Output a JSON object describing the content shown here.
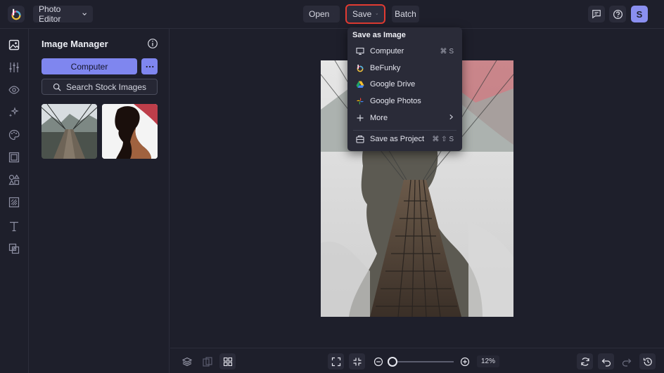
{
  "topbar": {
    "app_label": "Photo Editor",
    "open_label": "Open",
    "save_label": "Save",
    "batch_label": "Batch",
    "avatar_initial": "S"
  },
  "panel": {
    "title": "Image Manager",
    "computer_button": "Computer",
    "search_button": "Search Stock Images"
  },
  "save_menu": {
    "heading": "Save as Image",
    "items": [
      {
        "label": "Computer",
        "icon": "monitor-icon",
        "shortcut": "⌘ S"
      },
      {
        "label": "BeFunky",
        "icon": "befunky-icon",
        "shortcut": ""
      },
      {
        "label": "Google Drive",
        "icon": "google-drive-icon",
        "shortcut": ""
      },
      {
        "label": "Google Photos",
        "icon": "google-photos-icon",
        "shortcut": ""
      },
      {
        "label": "More",
        "icon": "plus-icon",
        "shortcut": ""
      },
      {
        "label": "Save as Project",
        "icon": "project-icon",
        "shortcut": "⌘ ⇧ S"
      }
    ]
  },
  "bottombar": {
    "zoom_value": "12%"
  },
  "colors": {
    "accent": "#7f86ef",
    "background": "#1e1f2b",
    "highlight_outline": "#e23b32"
  }
}
